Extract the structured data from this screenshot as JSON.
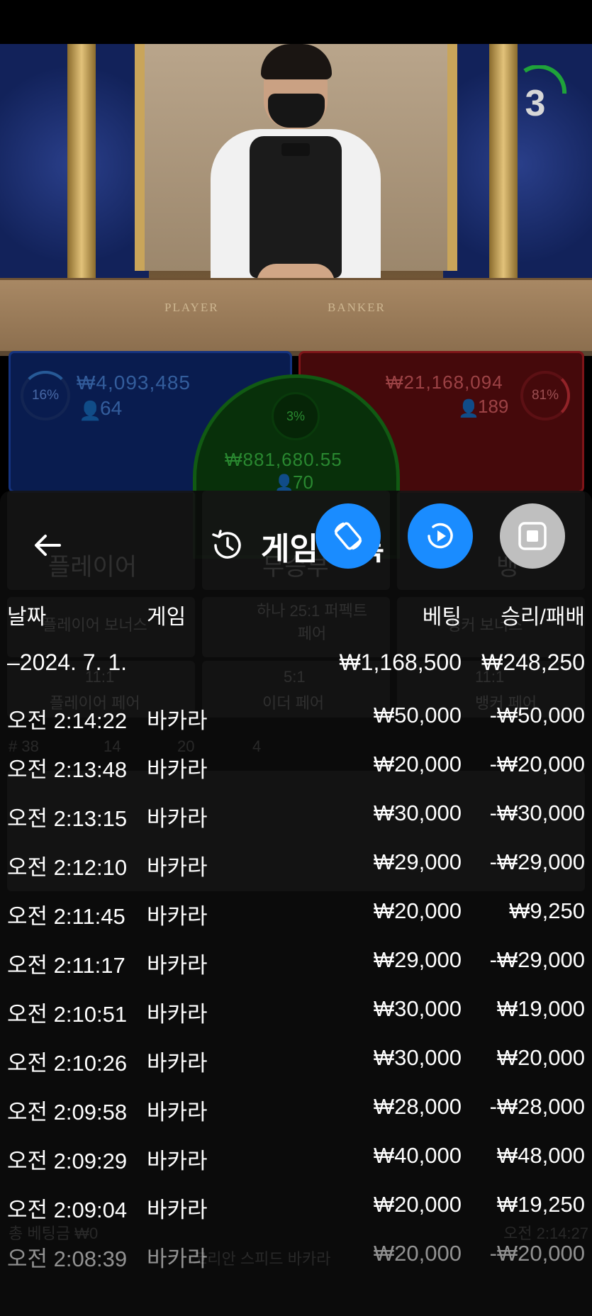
{
  "video": {
    "timer": "3",
    "table_labels": {
      "player": "PLAYER",
      "banker": "BANKER"
    }
  },
  "bets": {
    "player": {
      "percent": "16%",
      "amount": "₩4,093,485",
      "count": "64"
    },
    "tie": {
      "percent": "3%",
      "amount": "₩881,680.55",
      "count": "70"
    },
    "banker": {
      "percent": "81%",
      "amount": "₩21,168,094",
      "count": "189"
    }
  },
  "background_ghost": {
    "player_tab": "플레이어",
    "tie_tab": "무승부",
    "banker_tab": "뱅",
    "player_bonus": "플레이어 보너스",
    "perfect_pair": "하나 25:1 퍼펙트 페어",
    "banker_bonus": "뱅커 보너스",
    "player_pair": "플레이어 페어",
    "either_pair": "이더 페어",
    "banker_pair": "뱅커 페어",
    "pair_odds_left": "11:1",
    "pair_odds_mid": "5:1",
    "pair_odds_right": "11:1",
    "round": "# 38",
    "p_count": "14",
    "b_count": "20",
    "t_count": "4",
    "total_bet": "총 베팅금 ₩0",
    "game_name": "코리안 스피드 바카라",
    "clock": "오전 2:14:27"
  },
  "modal": {
    "title": "게임 기록",
    "headers": {
      "date": "날짜",
      "game": "게임",
      "bet": "베팅",
      "result": "승리/패배"
    },
    "summary": {
      "date": "–2024. 7. 1.",
      "bet": "₩1,168,500",
      "result": "₩248,250"
    },
    "rows": [
      {
        "time": "오전 2:14:22",
        "game": "바카라",
        "bet": "₩50,000",
        "result": "-₩50,000"
      },
      {
        "time": "오전 2:13:48",
        "game": "바카라",
        "bet": "₩20,000",
        "result": "-₩20,000"
      },
      {
        "time": "오전 2:13:15",
        "game": "바카라",
        "bet": "₩30,000",
        "result": "-₩30,000"
      },
      {
        "time": "오전 2:12:10",
        "game": "바카라",
        "bet": "₩29,000",
        "result": "-₩29,000"
      },
      {
        "time": "오전 2:11:45",
        "game": "바카라",
        "bet": "₩20,000",
        "result": "₩9,250"
      },
      {
        "time": "오전 2:11:17",
        "game": "바카라",
        "bet": "₩29,000",
        "result": "-₩29,000"
      },
      {
        "time": "오전 2:10:51",
        "game": "바카라",
        "bet": "₩30,000",
        "result": "₩19,000"
      },
      {
        "time": "오전 2:10:26",
        "game": "바카라",
        "bet": "₩30,000",
        "result": "₩20,000"
      },
      {
        "time": "오전 2:09:58",
        "game": "바카라",
        "bet": "₩28,000",
        "result": "-₩28,000"
      },
      {
        "time": "오전 2:09:29",
        "game": "바카라",
        "bet": "₩40,000",
        "result": "₩48,000"
      },
      {
        "time": "오전 2:09:04",
        "game": "바카라",
        "bet": "₩20,000",
        "result": "₩19,250"
      },
      {
        "time": "오전 2:08:39",
        "game": "바카라",
        "bet": "₩20,000",
        "result": "-₩20,000"
      }
    ]
  },
  "icons": {
    "back": "arrow-left-icon",
    "history": "history-icon",
    "rotate": "rotate-icon",
    "replay": "replay-icon",
    "stop": "stop-icon"
  },
  "colors": {
    "player_blue": "#1f4fc4",
    "banker_red": "#c41f26",
    "tie_green": "#1b8a1e",
    "fab_blue": "#1a8cff",
    "fab_grey": "#bfbfbf"
  }
}
